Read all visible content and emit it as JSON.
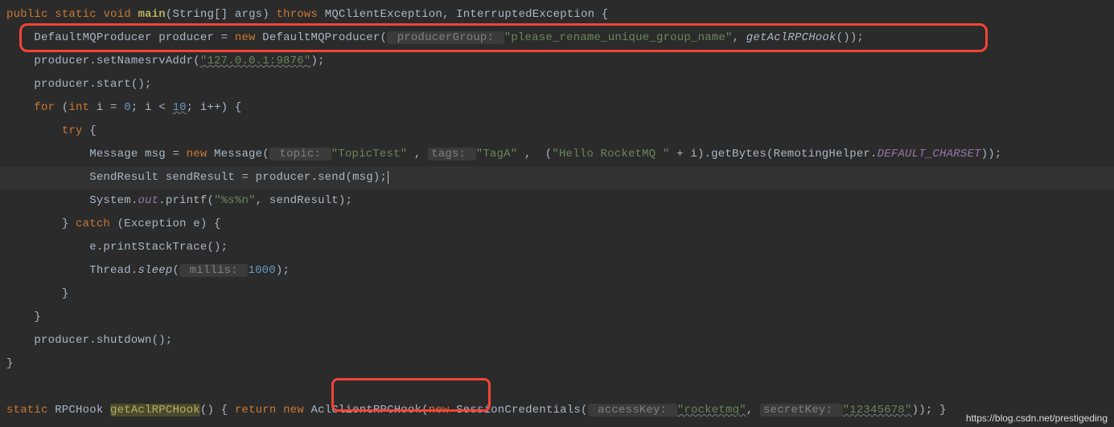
{
  "l1": {
    "public": "public",
    "static": "static",
    "void": "void",
    "main": "main",
    "sigopen": "(String[] args)",
    "throws": "throws",
    "ex1": "MQClientException,",
    "ex2": "InterruptedException",
    "brace": "{"
  },
  "l2": {
    "indent": "    ",
    "t1": "DefaultMQProducer producer = ",
    "new": "new",
    "t2": " DefaultMQProducer(",
    "hint1": " producerGroup: ",
    "str1": "\"please_rename_unique_group_name\"",
    "comma": ", ",
    "call": "getAclRPCHook",
    "after": "());"
  },
  "l3": {
    "indent": "    ",
    "t1": "producer.setNamesrvAddr(",
    "str": "\"127.0.0.1:9876\"",
    "after": ");"
  },
  "l4": {
    "indent": "    ",
    "t1": "producer.start();"
  },
  "l5": {
    "indent": "    ",
    "for": "for",
    "p1": " (",
    "int": "int",
    "p2": " i = ",
    "zero": "0",
    "p3": "; i < ",
    "ten": "10",
    "p4": "; i++) {"
  },
  "l6": {
    "indent": "        ",
    "try": "try",
    "brace": " {"
  },
  "l7": {
    "indent": "            ",
    "t1": "Message msg = ",
    "new": "new",
    "t2": " Message(",
    "h1": " topic: ",
    "s1": "\"TopicTest\" ",
    "c1": ", ",
    "h2": "tags: ",
    "s2": "\"TagA\" ",
    "c2": ", ",
    "p1": " (",
    "s3": "\"Hello RocketMQ \"",
    "p2": " + i).getBytes(RemotingHelper.",
    "const": "DEFAULT_CHARSET",
    "p3": "));"
  },
  "l8": {
    "indent": "            ",
    "t1": "SendResult sendResult = producer.send(msg);"
  },
  "l9": {
    "indent": "            ",
    "t1": "System.",
    "out": "out",
    "t2": ".printf(",
    "s1": "\"%s%n\"",
    "t3": ", sendResult);"
  },
  "l10": {
    "indent": "        ",
    "t1": "} ",
    "catch": "catch",
    "t2": " (Exception e) {"
  },
  "l11": {
    "indent": "            ",
    "t1": "e.printStackTrace();"
  },
  "l12": {
    "indent": "            ",
    "t1": "Thread.",
    "sleep": "sleep",
    "p1": "(",
    "hint": " millis: ",
    "num": "1000",
    "p2": ");"
  },
  "l13": {
    "indent": "        ",
    "t1": "}"
  },
  "l14": {
    "indent": "    ",
    "t1": "}"
  },
  "l15": {
    "indent": "    ",
    "t1": "producer.shutdown();"
  },
  "l16": {
    "t1": "}"
  },
  "l18": {
    "static": "static",
    "t1": " RPCHook ",
    "m": "getAclRPCHook",
    "t2": "() {",
    "ret": " return ",
    "new": "new",
    "t3": " AclClientRPCHook(",
    "new2": "new",
    "t4": " SessionCredentials(",
    "h1": " accessKey: ",
    "s1": "\"rocketmq\"",
    "c1": ", ",
    "h2": "secretKey: ",
    "s2": "\"12345678\"",
    "t5": ")); }"
  },
  "watermark": "https://blog.csdn.net/prestigeding"
}
